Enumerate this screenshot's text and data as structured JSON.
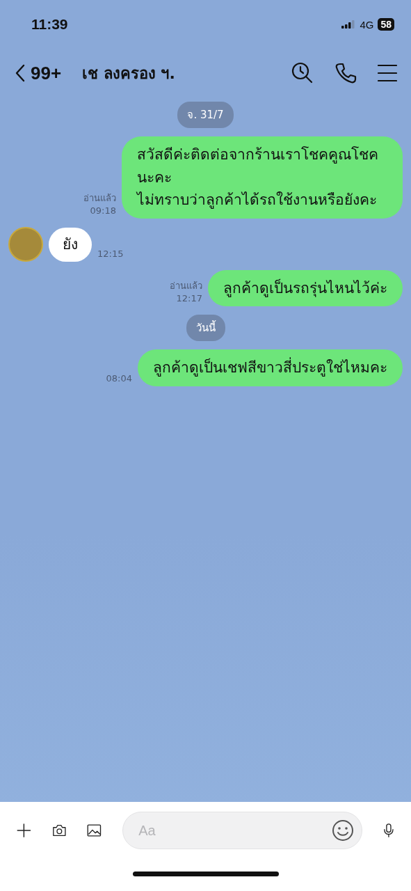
{
  "status_bar": {
    "time": "11:39",
    "network": "4G",
    "battery": "58"
  },
  "header": {
    "back_count": "99+",
    "title": "เช ลงครอง ฯ."
  },
  "messages": [
    {
      "kind": "date",
      "text": "จ. 31/7"
    },
    {
      "kind": "out",
      "text": "สวัสดีค่ะติดต่อจากร้านเราโชคคูณโชคนะคะ\nไม่ทราบว่าลูกค้าได้รถใช้งานหรือยังคะ",
      "read": "อ่านแล้ว",
      "time": "09:18"
    },
    {
      "kind": "in",
      "text": "ยัง",
      "time": "12:15"
    },
    {
      "kind": "out",
      "text": "ลูกค้าดูเป็นรถรุ่นไหนไว้ค่ะ",
      "read": "อ่านแล้ว",
      "time": "12:17"
    },
    {
      "kind": "date",
      "text": "วันนี้"
    },
    {
      "kind": "out",
      "text": "ลูกค้าดูเป็นเชฟสีขาวสี่ประตูใช่ไหมคะ",
      "time": "08:04"
    }
  ],
  "composer": {
    "placeholder": "Aa"
  }
}
